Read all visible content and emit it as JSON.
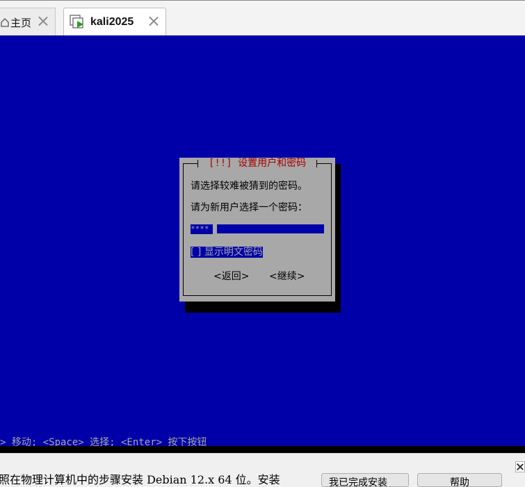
{
  "tabs": [
    {
      "label": "主页",
      "icon": "home-icon"
    },
    {
      "label": "kali2025",
      "icon": "vm-icon",
      "active": true
    }
  ],
  "screen": {
    "bg_color": "#0000a8",
    "dialog": {
      "title": "[!!] 设置用户和密码",
      "line1": "请选择较难被猜到的密码。",
      "line2": "请为新用户选择一个密码：",
      "password_masked": "****",
      "show_password_label": "[ ] 显示明文密码",
      "back_button": "<返回>",
      "continue_button": "<继续>"
    },
    "hint": "> 移动; <Space> 选择; <Enter> 按下按钮"
  },
  "bottom": {
    "text": "照在物理计算机中的步骤安装 Debian 12.x 64 位。安装",
    "button1": "我已完成安装",
    "button2": "帮助"
  }
}
